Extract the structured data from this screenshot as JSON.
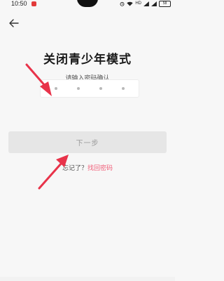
{
  "status_bar": {
    "time": "10:50",
    "network_label": "HD",
    "battery_level": "58"
  },
  "header": {
    "back_icon": "arrow-left-icon"
  },
  "main": {
    "title": "关闭青少年模式",
    "subtitle": "请输入密码确认",
    "pin_length": 4,
    "next_button_label": "下一步",
    "forgot_prefix": "忘记了？",
    "forgot_link": "找回密码"
  },
  "colors": {
    "background": "#f7f7f7",
    "button_disabled": "#e6e6e6",
    "link": "#f0607a",
    "annotation_arrow": "#e8334a"
  }
}
